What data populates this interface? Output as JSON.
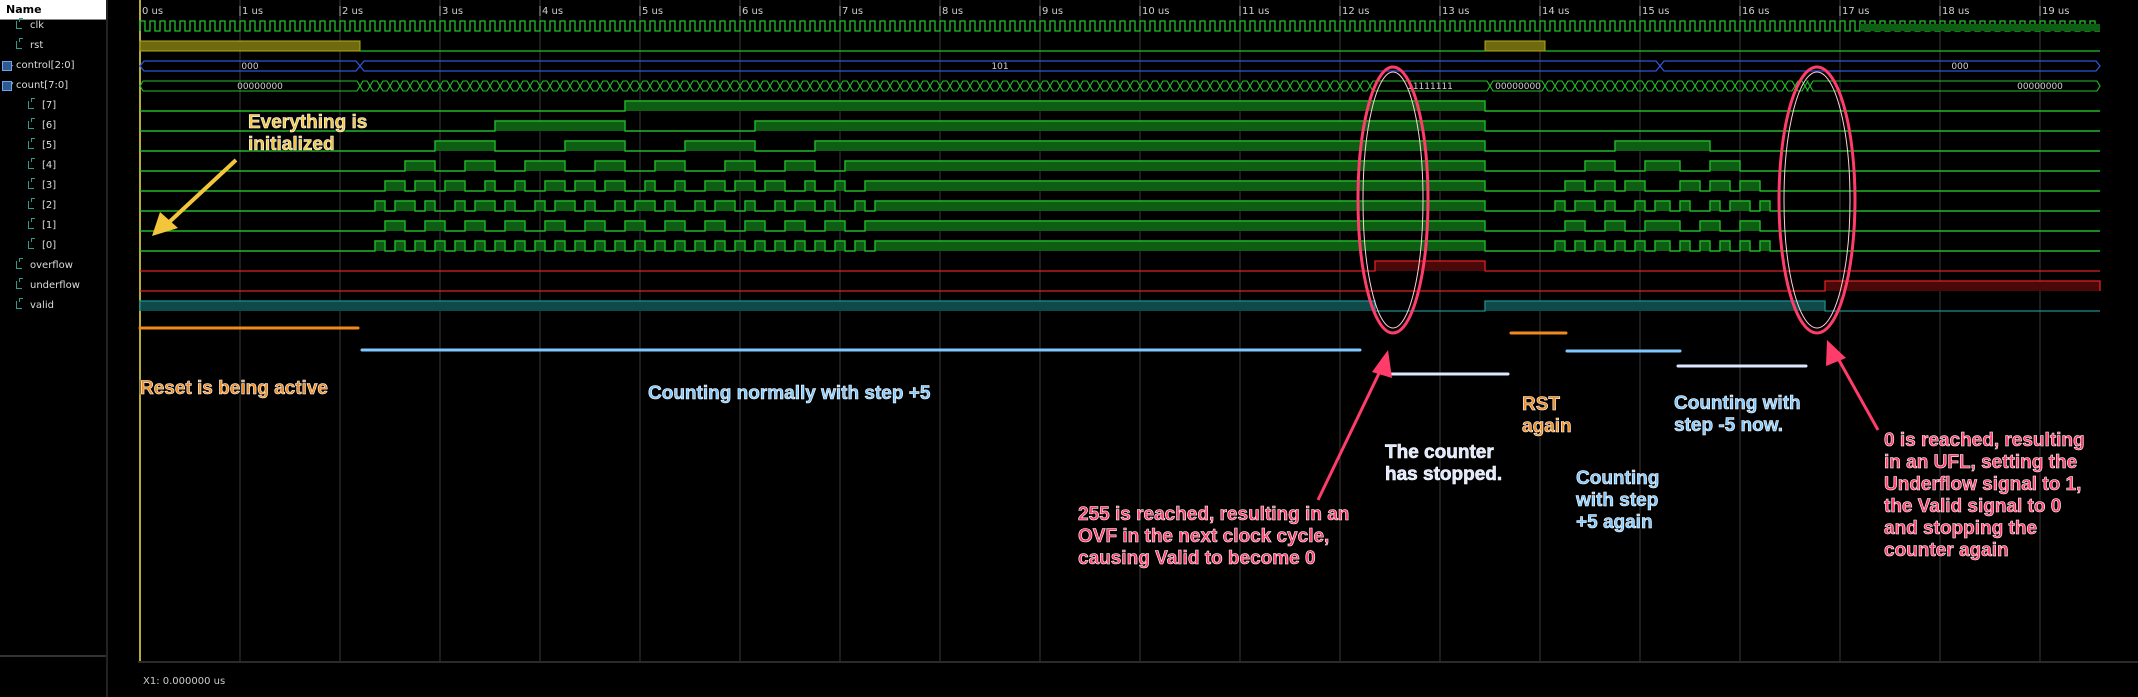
{
  "header": {
    "name_label": "Name"
  },
  "signals": [
    {
      "label": "clk",
      "icon": "bit-signal-icon",
      "twisty": ""
    },
    {
      "label": "rst",
      "icon": "bit-signal-icon",
      "twisty": ""
    },
    {
      "label": "control[2:0]",
      "icon": "bus-signal-icon",
      "twisty": "▶"
    },
    {
      "label": "count[7:0]",
      "icon": "bus-signal-icon",
      "twisty": "▼"
    },
    {
      "label": "[7]",
      "icon": "bit-signal-icon",
      "twisty": ""
    },
    {
      "label": "[6]",
      "icon": "bit-signal-icon",
      "twisty": ""
    },
    {
      "label": "[5]",
      "icon": "bit-signal-icon",
      "twisty": ""
    },
    {
      "label": "[4]",
      "icon": "bit-signal-icon",
      "twisty": ""
    },
    {
      "label": "[3]",
      "icon": "bit-signal-icon",
      "twisty": ""
    },
    {
      "label": "[2]",
      "icon": "bit-signal-icon",
      "twisty": ""
    },
    {
      "label": "[1]",
      "icon": "bit-signal-icon",
      "twisty": ""
    },
    {
      "label": "[0]",
      "icon": "bit-signal-icon",
      "twisty": ""
    },
    {
      "label": "overflow",
      "icon": "bit-signal-icon",
      "twisty": ""
    },
    {
      "label": "underflow",
      "icon": "bit-signal-icon",
      "twisty": ""
    },
    {
      "label": "valid",
      "icon": "bit-signal-icon",
      "twisty": ""
    }
  ],
  "timeline": {
    "ticks": [
      "0 us",
      "1 us",
      "2 us",
      "3 us",
      "4 us",
      "5 us",
      "6 us",
      "7 us",
      "8 us",
      "9 us",
      "10 us",
      "11 us",
      "12 us",
      "13 us",
      "14 us",
      "15 us",
      "16 us",
      "17 us",
      "18 us",
      "19 us"
    ]
  },
  "bus_values": {
    "control": [
      "000",
      "101",
      "000"
    ],
    "count": [
      "00000000",
      "11111111",
      "00000000",
      "00000000"
    ]
  },
  "cursor": {
    "label": "X1: 0.000000 us"
  },
  "annotations": {
    "initialized": "Everything is\ninitialized",
    "reset_active": "Reset is being active",
    "counting_up": "Counting normally with step +5",
    "overflow_note": "255 is reached, resulting in an\nOVF in the next clock cycle,\ncausing Valid to become 0",
    "stopped": "The counter\nhas stopped.",
    "rst_again": "RST\nagain",
    "counting_up_again": "Counting\nwith step\n+5 again",
    "counting_down": "Counting with\nstep -5 now.",
    "underflow_note": "0 is reached, resulting\nin an UFL, setting the\nUnderflow signal to 1,\nthe Valid signal to 0\nand stopping the\ncounter again"
  },
  "colors": {
    "wave": "#22c12a",
    "bus": "#2f55d6",
    "rst_fill": "#6e6a0d",
    "flag": "#e02020",
    "valid": "#1f8c8c",
    "annot_orange": "#f08a1c",
    "annot_yellow": "#f2c53d",
    "annot_blue": "#7fc8ff",
    "annot_pink": "#ff3c6a"
  }
}
